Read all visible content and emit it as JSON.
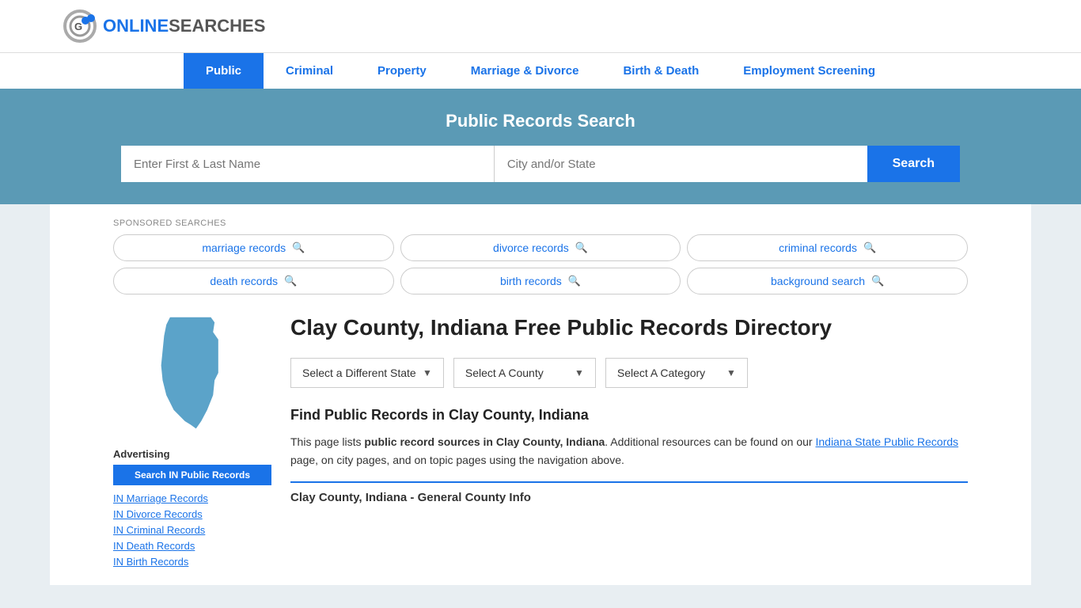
{
  "logo": {
    "online": "ONLINE",
    "searches": "SEARCHES"
  },
  "nav": {
    "items": [
      {
        "label": "Public",
        "active": true
      },
      {
        "label": "Criminal",
        "active": false
      },
      {
        "label": "Property",
        "active": false
      },
      {
        "label": "Marriage & Divorce",
        "active": false
      },
      {
        "label": "Birth & Death",
        "active": false
      },
      {
        "label": "Employment Screening",
        "active": false
      }
    ]
  },
  "banner": {
    "title": "Public Records Search",
    "name_placeholder": "Enter First & Last Name",
    "location_placeholder": "City and/or State",
    "search_button": "Search"
  },
  "sponsored": {
    "label": "SPONSORED SEARCHES",
    "pills": [
      {
        "text": "marriage records"
      },
      {
        "text": "divorce records"
      },
      {
        "text": "criminal records"
      },
      {
        "text": "death records"
      },
      {
        "text": "birth records"
      },
      {
        "text": "background search"
      }
    ]
  },
  "page": {
    "title": "Clay County, Indiana Free Public Records Directory",
    "dropdowns": {
      "state": "Select a Different State",
      "county": "Select A County",
      "category": "Select A Category"
    },
    "find_title": "Find Public Records in Clay County, Indiana",
    "description_part1": "This page lists ",
    "description_bold": "public record sources in Clay County, Indiana",
    "description_part2": ". Additional resources can be found on our ",
    "description_link": "Indiana State Public Records",
    "description_part3": " page, on city pages, and on topic pages using the navigation above.",
    "county_info_header": "Clay County, Indiana - General County Info"
  },
  "sidebar": {
    "advertising_label": "Advertising",
    "ad_button": "Search IN Public Records",
    "links": [
      {
        "text": "IN Marriage Records"
      },
      {
        "text": "IN Divorce Records"
      },
      {
        "text": "IN Criminal Records"
      },
      {
        "text": "IN Death Records"
      },
      {
        "text": "IN Birth Records"
      }
    ]
  }
}
